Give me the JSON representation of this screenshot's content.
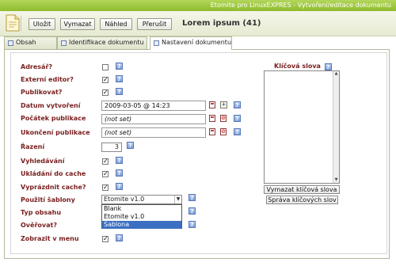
{
  "window_title": "Etomite pro LinuxEXPRES - Vytvoření/editace dokumentu",
  "toolbar": {
    "save_label": "Uložit",
    "delete_label": "Vymazat",
    "preview_label": "Náhled",
    "cancel_label": "Přerušit",
    "doc_title": "Lorem ipsum  (41)"
  },
  "tabs": [
    {
      "label": "Obsah"
    },
    {
      "label": "Identifikace dokumentu"
    },
    {
      "label": "Nastavení dokumentu"
    }
  ],
  "form": {
    "folder_label": "Adresář?",
    "folder_checked": false,
    "ext_editor_label": "Externí editor?",
    "ext_editor_checked": true,
    "published_label": "Publikovat?",
    "published_checked": true,
    "created_label": "Datum vytvoření",
    "created_value": "2009-03-05 @ 14:23",
    "pub_start_label": "Počátek publikace",
    "pub_start_value": "(not set)",
    "pub_end_label": "Ukončení publikace",
    "pub_end_value": "(not set)",
    "order_label": "Řazení",
    "order_value": "3",
    "searchable_label": "Vyhledávání",
    "searchable_checked": true,
    "cacheable_label": "Ukládání do cache",
    "cacheable_checked": true,
    "clear_cache_label": "Vyprázdnit cache?",
    "clear_cache_checked": true,
    "template_label": "Použití šablony",
    "template_value": "Etomite v1.0",
    "template_options": [
      "Blank",
      "Etomite v1.0",
      "Sablona"
    ],
    "template_highlighted": "Sablona",
    "content_type_label": "Typ obsahu",
    "auth_label": "Ověřovat?",
    "menu_label": "Zobrazit v menu",
    "menu_checked": true
  },
  "keywords": {
    "title": "Klíčová slova",
    "clear_button": "Vymazat klíčová slova",
    "manage_button": "Správa klíčových slov"
  },
  "help_glyph": "?",
  "check_glyph": "✓",
  "colors": {
    "titlebar": "#9cc43a",
    "label": "#7a2020",
    "selection": "#3b6fc1"
  }
}
